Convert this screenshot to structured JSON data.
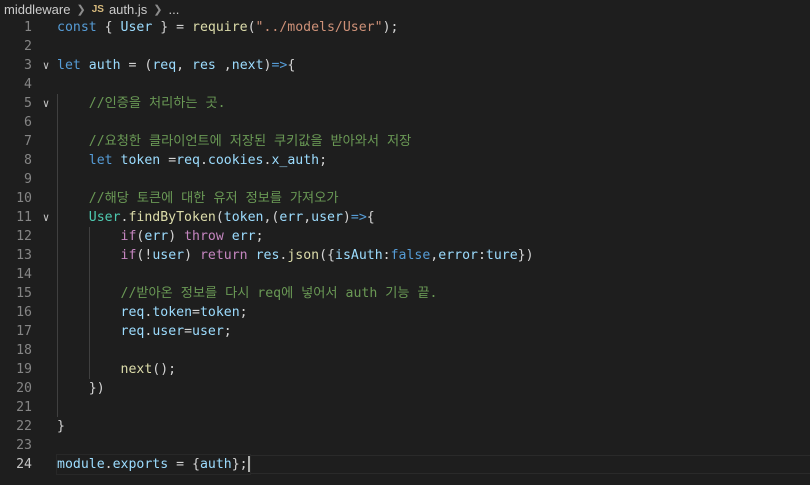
{
  "breadcrumb": {
    "folder": "middleware",
    "file_badge": "JS",
    "file": "auth.js",
    "ellipsis": "..."
  },
  "editor": {
    "current_line": 24,
    "lines": [
      {
        "n": "1",
        "fold": false,
        "indent": 0,
        "tokens": [
          [
            "const",
            "kw"
          ],
          [
            " { ",
            "pun"
          ],
          [
            "User",
            "var"
          ],
          [
            " } = ",
            "pun"
          ],
          [
            "require",
            "fn"
          ],
          [
            "(",
            "pun"
          ],
          [
            "\"../models/User\"",
            "str"
          ],
          [
            ");",
            "pun"
          ]
        ]
      },
      {
        "n": "2",
        "fold": false,
        "indent": 0,
        "tokens": []
      },
      {
        "n": "3",
        "fold": true,
        "indent": 0,
        "tokens": [
          [
            "let",
            "kw"
          ],
          [
            " ",
            "pun"
          ],
          [
            "auth",
            "var"
          ],
          [
            " = (",
            "pun"
          ],
          [
            "req",
            "var"
          ],
          [
            ", ",
            "pun"
          ],
          [
            "res",
            "var"
          ],
          [
            " ,",
            "pun"
          ],
          [
            "next",
            "var"
          ],
          [
            ")",
            "pun"
          ],
          [
            "=>",
            "kw"
          ],
          [
            "{",
            "pun"
          ]
        ]
      },
      {
        "n": "4",
        "fold": false,
        "indent": 0,
        "tokens": []
      },
      {
        "n": "5",
        "fold": true,
        "indent": 1,
        "tokens": [
          [
            "    //인증을 처리하는 곳.",
            "com"
          ]
        ]
      },
      {
        "n": "6",
        "fold": false,
        "indent": 1,
        "tokens": []
      },
      {
        "n": "7",
        "fold": false,
        "indent": 1,
        "tokens": [
          [
            "    //요청한 클라이언트에 저장된 쿠키값을 받아와서 저장",
            "com"
          ]
        ]
      },
      {
        "n": "8",
        "fold": false,
        "indent": 1,
        "tokens": [
          [
            "    ",
            "pun"
          ],
          [
            "let",
            "kw"
          ],
          [
            " ",
            "pun"
          ],
          [
            "token",
            "var"
          ],
          [
            " =",
            "pun"
          ],
          [
            "req",
            "var"
          ],
          [
            ".",
            "pun"
          ],
          [
            "cookies",
            "var"
          ],
          [
            ".",
            "pun"
          ],
          [
            "x_auth",
            "var"
          ],
          [
            ";",
            "pun"
          ]
        ]
      },
      {
        "n": "9",
        "fold": false,
        "indent": 1,
        "tokens": []
      },
      {
        "n": "10",
        "fold": false,
        "indent": 1,
        "tokens": [
          [
            "    //해당 토큰에 대한 유저 정보를 가져오가",
            "com"
          ]
        ]
      },
      {
        "n": "11",
        "fold": true,
        "indent": 1,
        "tokens": [
          [
            "    ",
            "pun"
          ],
          [
            "User",
            "cls"
          ],
          [
            ".",
            "pun"
          ],
          [
            "findByToken",
            "fn"
          ],
          [
            "(",
            "pun"
          ],
          [
            "token",
            "var"
          ],
          [
            ",(",
            "pun"
          ],
          [
            "err",
            "var"
          ],
          [
            ",",
            "pun"
          ],
          [
            "user",
            "var"
          ],
          [
            ")",
            "pun"
          ],
          [
            "=>",
            "kw"
          ],
          [
            "{",
            "pun"
          ]
        ]
      },
      {
        "n": "12",
        "fold": false,
        "indent": 2,
        "tokens": [
          [
            "        ",
            "pun"
          ],
          [
            "if",
            "ctrl"
          ],
          [
            "(",
            "pun"
          ],
          [
            "err",
            "var"
          ],
          [
            ") ",
            "pun"
          ],
          [
            "throw",
            "ctrl"
          ],
          [
            " ",
            "pun"
          ],
          [
            "err",
            "var"
          ],
          [
            ";",
            "pun"
          ]
        ]
      },
      {
        "n": "13",
        "fold": false,
        "indent": 2,
        "tokens": [
          [
            "        ",
            "pun"
          ],
          [
            "if",
            "ctrl"
          ],
          [
            "(!",
            "pun"
          ],
          [
            "user",
            "var"
          ],
          [
            ") ",
            "pun"
          ],
          [
            "return",
            "ctrl"
          ],
          [
            " ",
            "pun"
          ],
          [
            "res",
            "var"
          ],
          [
            ".",
            "pun"
          ],
          [
            "json",
            "fn"
          ],
          [
            "({",
            "pun"
          ],
          [
            "isAuth",
            "var"
          ],
          [
            ":",
            "pun"
          ],
          [
            "false",
            "kw"
          ],
          [
            ",",
            "pun"
          ],
          [
            "error",
            "var"
          ],
          [
            ":",
            "pun"
          ],
          [
            "ture",
            "var"
          ],
          [
            "})",
            "pun"
          ]
        ]
      },
      {
        "n": "14",
        "fold": false,
        "indent": 2,
        "tokens": []
      },
      {
        "n": "15",
        "fold": false,
        "indent": 2,
        "tokens": [
          [
            "        //받아온 정보를 다시 req에 넣어서 auth 기능 끝.",
            "com"
          ]
        ]
      },
      {
        "n": "16",
        "fold": false,
        "indent": 2,
        "tokens": [
          [
            "        ",
            "pun"
          ],
          [
            "req",
            "var"
          ],
          [
            ".",
            "pun"
          ],
          [
            "token",
            "var"
          ],
          [
            "=",
            "pun"
          ],
          [
            "token",
            "var"
          ],
          [
            ";",
            "pun"
          ]
        ]
      },
      {
        "n": "17",
        "fold": false,
        "indent": 2,
        "tokens": [
          [
            "        ",
            "pun"
          ],
          [
            "req",
            "var"
          ],
          [
            ".",
            "pun"
          ],
          [
            "user",
            "var"
          ],
          [
            "=",
            "pun"
          ],
          [
            "user",
            "var"
          ],
          [
            ";",
            "pun"
          ]
        ]
      },
      {
        "n": "18",
        "fold": false,
        "indent": 2,
        "tokens": []
      },
      {
        "n": "19",
        "fold": false,
        "indent": 2,
        "tokens": [
          [
            "        ",
            "pun"
          ],
          [
            "next",
            "fn"
          ],
          [
            "();",
            "pun"
          ]
        ]
      },
      {
        "n": "20",
        "fold": false,
        "indent": 1,
        "tokens": [
          [
            "    })",
            "pun"
          ]
        ]
      },
      {
        "n": "21",
        "fold": false,
        "indent": 1,
        "tokens": []
      },
      {
        "n": "22",
        "fold": false,
        "indent": 0,
        "tokens": [
          [
            "}",
            "pun"
          ]
        ]
      },
      {
        "n": "23",
        "fold": false,
        "indent": 0,
        "tokens": []
      },
      {
        "n": "24",
        "fold": false,
        "indent": 0,
        "tokens": [
          [
            "module",
            "var"
          ],
          [
            ".",
            "pun"
          ],
          [
            "exports",
            "var"
          ],
          [
            " = {",
            "pun"
          ],
          [
            "auth",
            "var"
          ],
          [
            "};",
            "pun"
          ]
        ]
      }
    ]
  }
}
